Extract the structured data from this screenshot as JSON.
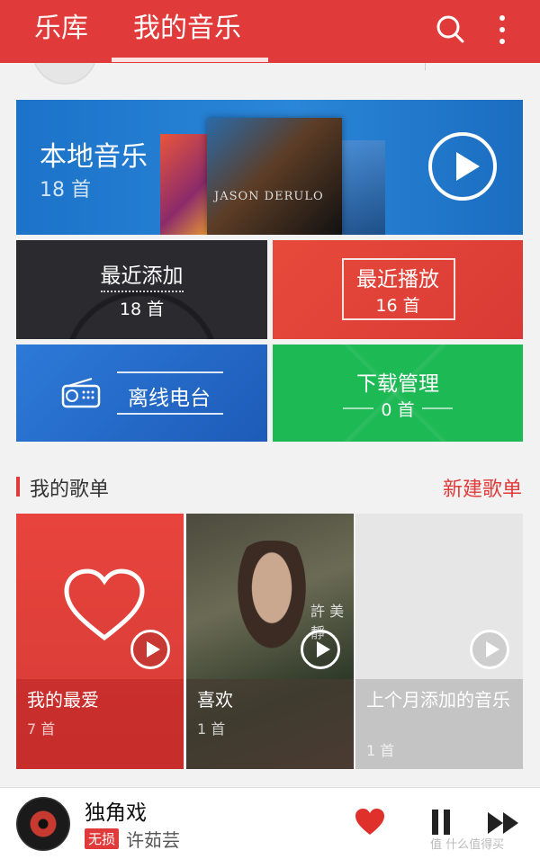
{
  "header": {
    "tabs": [
      {
        "label": "乐库"
      },
      {
        "label": "我的音乐"
      }
    ],
    "icons": [
      "search-icon",
      "more-vertical-icon"
    ],
    "accent_color": "#e03a3a"
  },
  "local_music": {
    "title": "本地音乐",
    "count": "18 首",
    "album_text": "JASON DERULO"
  },
  "tiles": {
    "recent_added": {
      "label": "最近添加",
      "count": "18 首"
    },
    "recent_played": {
      "label": "最近播放",
      "count": "16 首"
    },
    "offline_radio": {
      "label": "离线电台"
    },
    "download": {
      "label": "下载管理",
      "count": "0 首"
    }
  },
  "playlists": {
    "title": "我的歌单",
    "new_label": "新建歌单",
    "items": [
      {
        "name": "我的最爱",
        "count": "7 首"
      },
      {
        "name": "喜欢",
        "count": "1 首"
      },
      {
        "name": "上个月添加的音乐",
        "count": "1 首"
      }
    ],
    "cover_text": "許 美靜"
  },
  "player": {
    "song": "独角戏",
    "badge": "无损",
    "artist": "许茹芸",
    "watermark": "值 什么值得买"
  }
}
